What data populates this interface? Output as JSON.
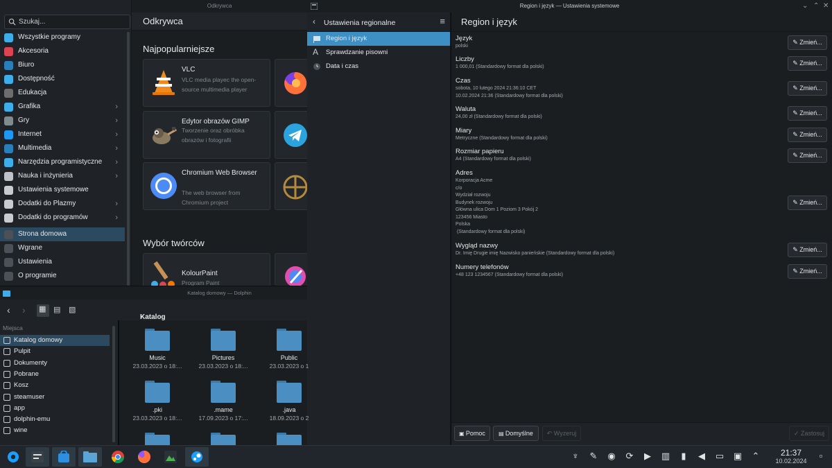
{
  "discover": {
    "window_title": "Odkrywca",
    "page_title": "Odkrywca",
    "search_placeholder": "Szukaj...",
    "categories": [
      {
        "label": "Wszystkie programy",
        "icon": "apps-grid-icon",
        "color": "#3daee9",
        "chevron": ""
      },
      {
        "label": "Akcesoria",
        "icon": "accessories-icon",
        "color": "#da4453",
        "chevron": ""
      },
      {
        "label": "Biuro",
        "icon": "office-icon",
        "color": "#2980b9",
        "chevron": ""
      },
      {
        "label": "Dostępność",
        "icon": "accessibility-icon",
        "color": "#3daee9",
        "chevron": ""
      },
      {
        "label": "Edukacja",
        "icon": "education-icon",
        "color": "#6d6d6d",
        "chevron": ""
      },
      {
        "label": "Grafika",
        "icon": "graphics-icon",
        "color": "#3daee9",
        "chevron": "›"
      },
      {
        "label": "Gry",
        "icon": "games-icon",
        "color": "#7f8c8d",
        "chevron": "›"
      },
      {
        "label": "Internet",
        "icon": "internet-icon",
        "color": "#1d99f3",
        "chevron": "›"
      },
      {
        "label": "Multimedia",
        "icon": "multimedia-icon",
        "color": "#2980b9",
        "chevron": "›"
      },
      {
        "label": "Narzędzia programistyczne",
        "icon": "dev-tools-icon",
        "color": "#3daee9",
        "chevron": "›"
      },
      {
        "label": "Nauka i inżynieria",
        "icon": "science-icon",
        "color": "#bdc3c7",
        "chevron": "›"
      },
      {
        "label": "Ustawienia systemowe",
        "icon": "system-settings-icon",
        "color": "#c8ccd0",
        "chevron": ""
      },
      {
        "label": "Dodatki do Plazmy",
        "icon": "plasma-addons-icon",
        "color": "#c8ccd0",
        "chevron": "›"
      },
      {
        "label": "Dodatki do programów",
        "icon": "app-addons-icon",
        "color": "#c8ccd0",
        "chevron": "›"
      }
    ],
    "home": {
      "label": "Strona domowa",
      "icon": "home-icon"
    },
    "bottom_items": [
      {
        "label": "Wgrane",
        "icon": "installed-icon"
      },
      {
        "label": "Ustawienia",
        "icon": "settings-sliders-icon"
      },
      {
        "label": "O programie",
        "icon": "info-icon"
      }
    ],
    "popular_title": "Najpopularniejsze",
    "popular": [
      {
        "name": "VLC",
        "desc": "VLC media playec the open-source multimedia player",
        "icon": "vlc-icon"
      },
      {
        "name": "Edytor obrazów GIMP",
        "desc": "Tworzenie oraz obróbka obrazów i fotografii",
        "icon": "gimp-icon"
      },
      {
        "name": "Chromium Web Browser",
        "desc": "The web browser from Chromium project",
        "icon": "chromium-icon"
      }
    ],
    "editors_title": "Wybór twórców",
    "editors": [
      {
        "name": "KolourPaint",
        "desc": "Program Paint",
        "icon": "kolourpaint-icon"
      }
    ]
  },
  "settings": {
    "window_title": "Region i język — Ustawienia systemowe",
    "side_title": "Ustawienia regionalne",
    "nav": [
      {
        "label": "Region i język",
        "icon": "flag-icon"
      },
      {
        "label": "Sprawdzanie pisowni",
        "icon": "spellcheck-icon"
      },
      {
        "label": "Data i czas",
        "icon": "clock-icon"
      }
    ],
    "page_title": "Region i język",
    "change_label": "Zmień...",
    "rows": [
      {
        "label": "Język",
        "value": "polski"
      },
      {
        "label": "Liczby",
        "value": "1 000,01 (Standardowy format dla polski)"
      },
      {
        "label": "Czas",
        "value": "sobota, 10 lutego 2024 21:36:10 CET\n10.02.2024 21:36 (Standardowy format dla polski)"
      },
      {
        "label": "Waluta",
        "value": "24,00 zł (Standardowy format dla polski)"
      },
      {
        "label": "Miary",
        "value": "Metryczne (Standardowy format dla polski)"
      },
      {
        "label": "Rozmiar papieru",
        "value": "A4 (Standardowy format dla polski)"
      },
      {
        "label": "Adres",
        "value": "Korporacja Acme\nc/o\nWydział rozwoju\nBudynek rozwoju\nGłówna ulica Dom 1 Poziom 3 Pokój 2\n123456 Miasto\nPolska\n (Standardowy format dla polski)"
      },
      {
        "label": "Wygląd nazwy",
        "value": "Dr. Imię Drugie imię Nazwisko panieńskie (Standardowy format dla polski)"
      },
      {
        "label": "Numery telefonów",
        "value": "+48 123 1234567 (Standardowy format dla polski)"
      }
    ],
    "footer": {
      "help": "Pomoc",
      "defaults": "Domyślne",
      "reset": "Wyzeruj",
      "apply": "Zastosuj"
    }
  },
  "dolphin": {
    "window_title": "Katalog domowy — Dolphin",
    "breadcrumb": "Katalog domowy",
    "places_title": "Miejsca",
    "places": [
      {
        "label": "Katalog domowy",
        "icon": "home-folder-icon"
      },
      {
        "label": "Pulpit",
        "icon": "desktop-icon"
      },
      {
        "label": "Dokumenty",
        "icon": "documents-icon"
      },
      {
        "label": "Pobrane",
        "icon": "download-icon"
      },
      {
        "label": "Kosz",
        "icon": "trash-icon"
      },
      {
        "label": "steamuser",
        "icon": "folder-icon"
      },
      {
        "label": "app",
        "icon": "folder-icon"
      },
      {
        "label": "dolphin-emu",
        "icon": "folder-icon"
      },
      {
        "label": "wine",
        "icon": "folder-icon"
      }
    ],
    "files": [
      {
        "name": "Music",
        "date": "23.03.2023 o 18:...",
        "icon": "music-folder-icon"
      },
      {
        "name": "Pictures",
        "date": "23.03.2023 o 18:...",
        "icon": "pictures-folder-icon"
      },
      {
        "name": "Public",
        "date": "23.03.2023 o 1",
        "icon": "public-folder-icon"
      },
      {
        "name": ".pki",
        "date": "23.03.2023 o 18:...",
        "icon": "folder-icon"
      },
      {
        "name": ".mame",
        "date": "17.09.2023 o 17:...",
        "icon": "folder-icon"
      },
      {
        "name": ".java",
        "date": "18.09.2023 o 2",
        "icon": "folder-icon"
      }
    ]
  },
  "taskbar": {
    "time": "21:37",
    "date": "10.02.2024",
    "apps": [
      "app-launcher-icon",
      "konsole-icon",
      "discover-icon",
      "dolphin-icon",
      "chrome-icon",
      "firefox-icon",
      "kolourpaint-icon",
      "steam-icon"
    ],
    "tray": [
      "notifications-icon",
      "pen-icon",
      "steam-tray-icon",
      "updates-icon",
      "media-icon",
      "clipboard-icon",
      "battery-icon",
      "volume-icon",
      "network-icon",
      "display-icon",
      "expand-tray-icon"
    ]
  },
  "colors": {
    "accent": "#3d8fc4",
    "selection": "#2b4a60",
    "folder": "#4a8ec2"
  }
}
